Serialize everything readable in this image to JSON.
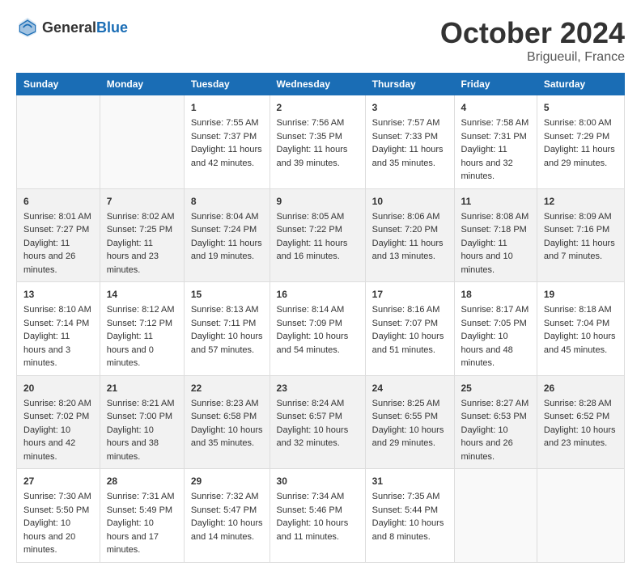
{
  "header": {
    "logo_general": "General",
    "logo_blue": "Blue",
    "month_title": "October 2024",
    "location": "Brigueuil, France"
  },
  "weekdays": [
    "Sunday",
    "Monday",
    "Tuesday",
    "Wednesday",
    "Thursday",
    "Friday",
    "Saturday"
  ],
  "rows": [
    [
      {
        "day": "",
        "content": ""
      },
      {
        "day": "",
        "content": ""
      },
      {
        "day": "1",
        "content": "Sunrise: 7:55 AM\nSunset: 7:37 PM\nDaylight: 11 hours and 42 minutes."
      },
      {
        "day": "2",
        "content": "Sunrise: 7:56 AM\nSunset: 7:35 PM\nDaylight: 11 hours and 39 minutes."
      },
      {
        "day": "3",
        "content": "Sunrise: 7:57 AM\nSunset: 7:33 PM\nDaylight: 11 hours and 35 minutes."
      },
      {
        "day": "4",
        "content": "Sunrise: 7:58 AM\nSunset: 7:31 PM\nDaylight: 11 hours and 32 minutes."
      },
      {
        "day": "5",
        "content": "Sunrise: 8:00 AM\nSunset: 7:29 PM\nDaylight: 11 hours and 29 minutes."
      }
    ],
    [
      {
        "day": "6",
        "content": "Sunrise: 8:01 AM\nSunset: 7:27 PM\nDaylight: 11 hours and 26 minutes."
      },
      {
        "day": "7",
        "content": "Sunrise: 8:02 AM\nSunset: 7:25 PM\nDaylight: 11 hours and 23 minutes."
      },
      {
        "day": "8",
        "content": "Sunrise: 8:04 AM\nSunset: 7:24 PM\nDaylight: 11 hours and 19 minutes."
      },
      {
        "day": "9",
        "content": "Sunrise: 8:05 AM\nSunset: 7:22 PM\nDaylight: 11 hours and 16 minutes."
      },
      {
        "day": "10",
        "content": "Sunrise: 8:06 AM\nSunset: 7:20 PM\nDaylight: 11 hours and 13 minutes."
      },
      {
        "day": "11",
        "content": "Sunrise: 8:08 AM\nSunset: 7:18 PM\nDaylight: 11 hours and 10 minutes."
      },
      {
        "day": "12",
        "content": "Sunrise: 8:09 AM\nSunset: 7:16 PM\nDaylight: 11 hours and 7 minutes."
      }
    ],
    [
      {
        "day": "13",
        "content": "Sunrise: 8:10 AM\nSunset: 7:14 PM\nDaylight: 11 hours and 3 minutes."
      },
      {
        "day": "14",
        "content": "Sunrise: 8:12 AM\nSunset: 7:12 PM\nDaylight: 11 hours and 0 minutes."
      },
      {
        "day": "15",
        "content": "Sunrise: 8:13 AM\nSunset: 7:11 PM\nDaylight: 10 hours and 57 minutes."
      },
      {
        "day": "16",
        "content": "Sunrise: 8:14 AM\nSunset: 7:09 PM\nDaylight: 10 hours and 54 minutes."
      },
      {
        "day": "17",
        "content": "Sunrise: 8:16 AM\nSunset: 7:07 PM\nDaylight: 10 hours and 51 minutes."
      },
      {
        "day": "18",
        "content": "Sunrise: 8:17 AM\nSunset: 7:05 PM\nDaylight: 10 hours and 48 minutes."
      },
      {
        "day": "19",
        "content": "Sunrise: 8:18 AM\nSunset: 7:04 PM\nDaylight: 10 hours and 45 minutes."
      }
    ],
    [
      {
        "day": "20",
        "content": "Sunrise: 8:20 AM\nSunset: 7:02 PM\nDaylight: 10 hours and 42 minutes."
      },
      {
        "day": "21",
        "content": "Sunrise: 8:21 AM\nSunset: 7:00 PM\nDaylight: 10 hours and 38 minutes."
      },
      {
        "day": "22",
        "content": "Sunrise: 8:23 AM\nSunset: 6:58 PM\nDaylight: 10 hours and 35 minutes."
      },
      {
        "day": "23",
        "content": "Sunrise: 8:24 AM\nSunset: 6:57 PM\nDaylight: 10 hours and 32 minutes."
      },
      {
        "day": "24",
        "content": "Sunrise: 8:25 AM\nSunset: 6:55 PM\nDaylight: 10 hours and 29 minutes."
      },
      {
        "day": "25",
        "content": "Sunrise: 8:27 AM\nSunset: 6:53 PM\nDaylight: 10 hours and 26 minutes."
      },
      {
        "day": "26",
        "content": "Sunrise: 8:28 AM\nSunset: 6:52 PM\nDaylight: 10 hours and 23 minutes."
      }
    ],
    [
      {
        "day": "27",
        "content": "Sunrise: 7:30 AM\nSunset: 5:50 PM\nDaylight: 10 hours and 20 minutes."
      },
      {
        "day": "28",
        "content": "Sunrise: 7:31 AM\nSunset: 5:49 PM\nDaylight: 10 hours and 17 minutes."
      },
      {
        "day": "29",
        "content": "Sunrise: 7:32 AM\nSunset: 5:47 PM\nDaylight: 10 hours and 14 minutes."
      },
      {
        "day": "30",
        "content": "Sunrise: 7:34 AM\nSunset: 5:46 PM\nDaylight: 10 hours and 11 minutes."
      },
      {
        "day": "31",
        "content": "Sunrise: 7:35 AM\nSunset: 5:44 PM\nDaylight: 10 hours and 8 minutes."
      },
      {
        "day": "",
        "content": ""
      },
      {
        "day": "",
        "content": ""
      }
    ]
  ]
}
